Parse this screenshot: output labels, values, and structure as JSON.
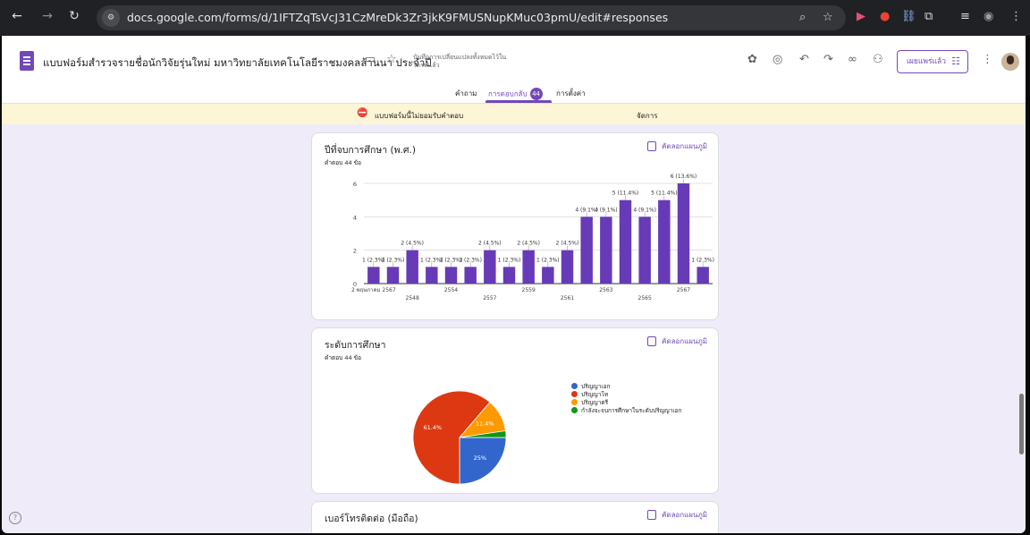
{
  "browser": {
    "url": "docs.google.com/forms/d/1IFTZqTsVcJ31CzMreDk3Zr3jkK9FMUSNupKMuc03pmU/edit#responses",
    "site_icon": "tune-icon",
    "nav": [
      "back-icon",
      "forward-icon",
      "reload-icon"
    ]
  },
  "header": {
    "form_title": "แบบฟอร์มสำรวจรายชื่อนักวิจัยรุ่นใหม่ มหาวิทยาลัยเทคโนโลยีราชมงคลล้านนา ประจำปี",
    "saved_status": "บันทึกการเปลี่ยนแปลงทั้งหมดไว้ในไดรฟ์แล้ว",
    "publish_label": "เผยแพร่แล้ว"
  },
  "tabs": {
    "questions": "คำถาม",
    "responses": "การตอบกลับ",
    "response_count": "44",
    "settings": "การตั้งค่า"
  },
  "banner": {
    "text": "แบบฟอร์มนี้ไม่ยอมรับคำตอบ",
    "manage": "จัดการ"
  },
  "copy_chart_label": "คัดลอกแผนภูมิ",
  "cards": [
    {
      "title": "ปีที่จบการศึกษา (พ.ศ.)",
      "subtitle": "คำตอบ 44 ข้อ"
    },
    {
      "title": "ระดับการศึกษา",
      "subtitle": "คำตอบ 44 ข้อ"
    },
    {
      "title": "เบอร์โทรติดต่อ (มือถือ)"
    }
  ],
  "chart_data": [
    {
      "type": "bar",
      "categories": [
        "2 พฤษภาคม 2567",
        "",
        "2548",
        "",
        "2554",
        "",
        "2557",
        "",
        "2559",
        "",
        "2561",
        "",
        "2563",
        "",
        "2565",
        "",
        "2567",
        ""
      ],
      "tick_labels_row1": [
        "2 พฤษภาคม 2567",
        "2554",
        "2559",
        "2563",
        "2567"
      ],
      "tick_labels_row2": [
        "2548",
        "2557",
        "2561",
        "2565"
      ],
      "values": [
        1,
        1,
        2,
        1,
        1,
        1,
        2,
        1,
        2,
        1,
        2,
        4,
        4,
        5,
        4,
        5,
        6,
        1
      ],
      "labels": [
        "1 (2.3%)",
        "1 (2.3%)",
        "2 (4.5%)",
        "1 (2.3%)",
        "1 (2.3%)",
        "1 (2.3%)",
        "2 (4.5%)",
        "1 (2.3%)",
        "2 (4.5%)",
        "1 (2.3%)",
        "2 (4.5%)",
        "4 (9.1%)",
        "4 (9.1%)",
        "5 (11.4%)",
        "4 (9.1%)",
        "5 (11.4%)",
        "6 (13.6%)",
        "1 (2.3%)"
      ],
      "ylim": [
        0,
        6
      ],
      "yticks": [
        0,
        2,
        4,
        6
      ],
      "color": "#673ab7"
    },
    {
      "type": "pie",
      "slices": [
        {
          "name": "ปริญญาเอก",
          "value": 25,
          "label": "25%",
          "color": "#3366cc"
        },
        {
          "name": "ปริญญาโท",
          "value": 61.4,
          "label": "61.4%",
          "color": "#dc3912"
        },
        {
          "name": "ปริญญาตรี",
          "value": 11.4,
          "label": "11.4%",
          "color": "#ff9900"
        },
        {
          "name": "กำลังจะจบการศึกษาในระดับปริญญาเอก",
          "value": 2.3,
          "label": "",
          "color": "#109618"
        }
      ]
    }
  ]
}
